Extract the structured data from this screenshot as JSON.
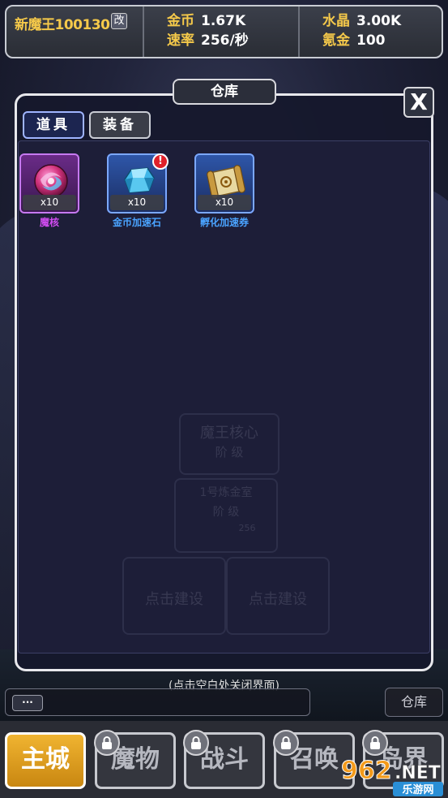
{
  "topbar": {
    "player_name": "新魔王100130",
    "rename_label": "改",
    "gold_label": "金币",
    "gold_value": "1.67K",
    "rate_label": "速率",
    "rate_value": "256/秒",
    "crystal_label": "水晶",
    "crystal_value": "3.00K",
    "krypton_label": "氪金",
    "krypton_value": "100"
  },
  "panel": {
    "title": "仓库",
    "close_label": "X",
    "tabs": [
      {
        "label": "道具",
        "active": true
      },
      {
        "label": "装备",
        "active": false
      }
    ],
    "items": [
      {
        "name": "魔核",
        "count": "x10",
        "name_color": "#d04cf0",
        "icon": "magic-core-orb-icon",
        "badge": ""
      },
      {
        "name": "金币加速石",
        "count": "x10",
        "name_color": "#4aa3ff",
        "icon": "blue-gem-icon",
        "badge": "!"
      },
      {
        "name": "孵化加速券",
        "count": "x10",
        "name_color": "#4aa3ff",
        "icon": "scroll-icon",
        "badge": ""
      }
    ]
  },
  "background": {
    "core_title": "魔王核心",
    "core_level": "阶 级",
    "mine_title": "1号炼金室",
    "mine_level": "阶 级",
    "mine_rate": "256",
    "build_1": "点击建设",
    "build_2": "点击建设"
  },
  "hint": "(点击空白处关闭界面)",
  "chat": {
    "dots": "···"
  },
  "warehouse_button": "仓库",
  "nav": [
    {
      "label": "主城",
      "active": true,
      "locked": false
    },
    {
      "label": "魔物",
      "active": false,
      "locked": true
    },
    {
      "label": "战斗",
      "active": false,
      "locked": true
    },
    {
      "label": "召唤",
      "active": false,
      "locked": true
    },
    {
      "label": "岛界",
      "active": false,
      "locked": true
    }
  ],
  "watermark": {
    "brand": "962.NET",
    "sub": "乐游网"
  },
  "colors": {
    "gold": "#f5c94a",
    "active_tab": "#1c2550",
    "nav_active": "#e0a124"
  }
}
